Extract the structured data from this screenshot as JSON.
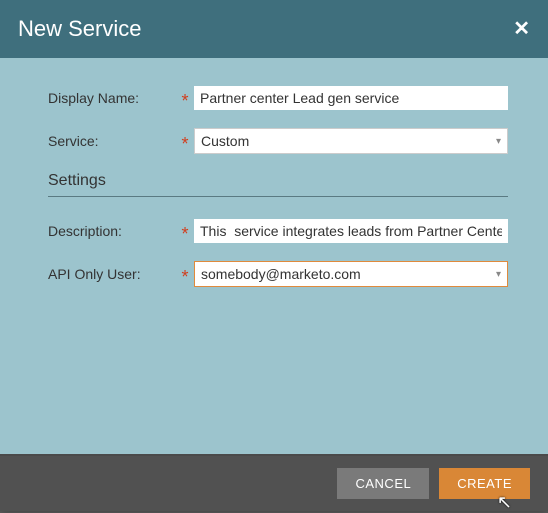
{
  "header": {
    "title": "New Service"
  },
  "form": {
    "display_name": {
      "label": "Display Name:",
      "value": "Partner center Lead gen service"
    },
    "service": {
      "label": "Service:",
      "value": "Custom"
    },
    "settings_heading": "Settings",
    "description": {
      "label": "Description:",
      "value": "This  service integrates leads from Partner Center"
    },
    "api_only_user": {
      "label": "API Only User:",
      "value": "somebody@marketo.com"
    }
  },
  "footer": {
    "cancel_label": "CANCEL",
    "create_label": "CREATE"
  }
}
